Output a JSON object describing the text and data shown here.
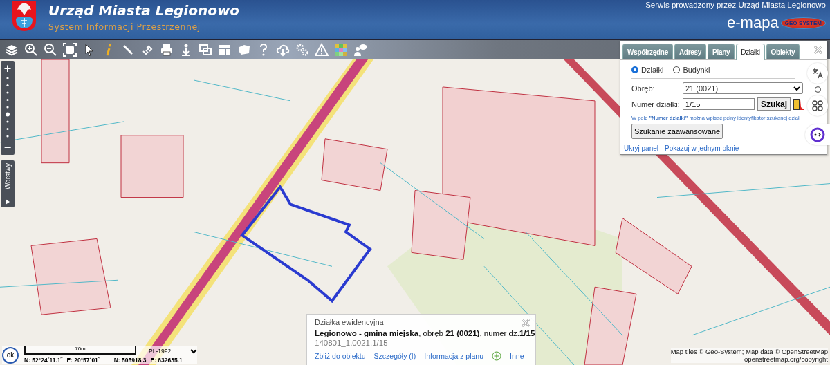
{
  "header": {
    "title": "Urząd Miasta Legionowo",
    "subtitle": "System Informacji Przestrzennej",
    "operator": "Serwis prowadzony przez Urząd Miasta Legionowo",
    "brand": "e-mapa",
    "brand_badge": "GEO-SYSTEM"
  },
  "map_controls": {
    "zoom_in": "+",
    "zoom_out": "−",
    "layers_tab": "Warstwy",
    "zoom_level": {
      "level": 0.375
    }
  },
  "search_panel": {
    "tabs": [
      {
        "label": "Współrzędne",
        "selected": false
      },
      {
        "label": "Adresy",
        "selected": false
      },
      {
        "label": "Plany",
        "selected": false
      },
      {
        "label": "Działki",
        "selected": true
      },
      {
        "label": "Obiekty",
        "selected": false
      }
    ],
    "radios": [
      {
        "label": "Działki",
        "selected": true
      },
      {
        "label": "Budynki",
        "selected": false
      }
    ],
    "precinct": {
      "label": "Obręb:",
      "value": "21 (0021)"
    },
    "parcel_number": {
      "label": "Numer działki:",
      "value": "1/15"
    },
    "search_button": "Szukaj",
    "hint": "W pole **\"Numer działki\"** można wpisać pełny identyfikator szukanej dział",
    "advanced_button": "Szukanie zaawansowane",
    "links": [
      "Ukryj panel",
      "Pokazuj w jednym oknie"
    ]
  },
  "popup": {
    "heading": "Działka ewidencyjna",
    "description": "**Legionowo - gmina miejska**, obręb **21 (0021)**, numer dz.**1/15**",
    "identifier": "140801_1.0021.1/15",
    "actions": [
      "Zbliż do obiektu",
      "Szczegóły (I)",
      "Informacja z planu",
      "Inne"
    ]
  },
  "coordinates": {
    "ok": "ok",
    "scale_label": "70m",
    "crs": "PL-1992",
    "lat": "N: 52°24´11.1˝",
    "lon": "E: 20°57´01˝",
    "north": "N: 505918.3",
    "east": "E: 632635.1"
  },
  "attribution": [
    "Map tiles © Geo-System; Map data © OpenStreetMap",
    "openstreetmap.org/copyright"
  ]
}
